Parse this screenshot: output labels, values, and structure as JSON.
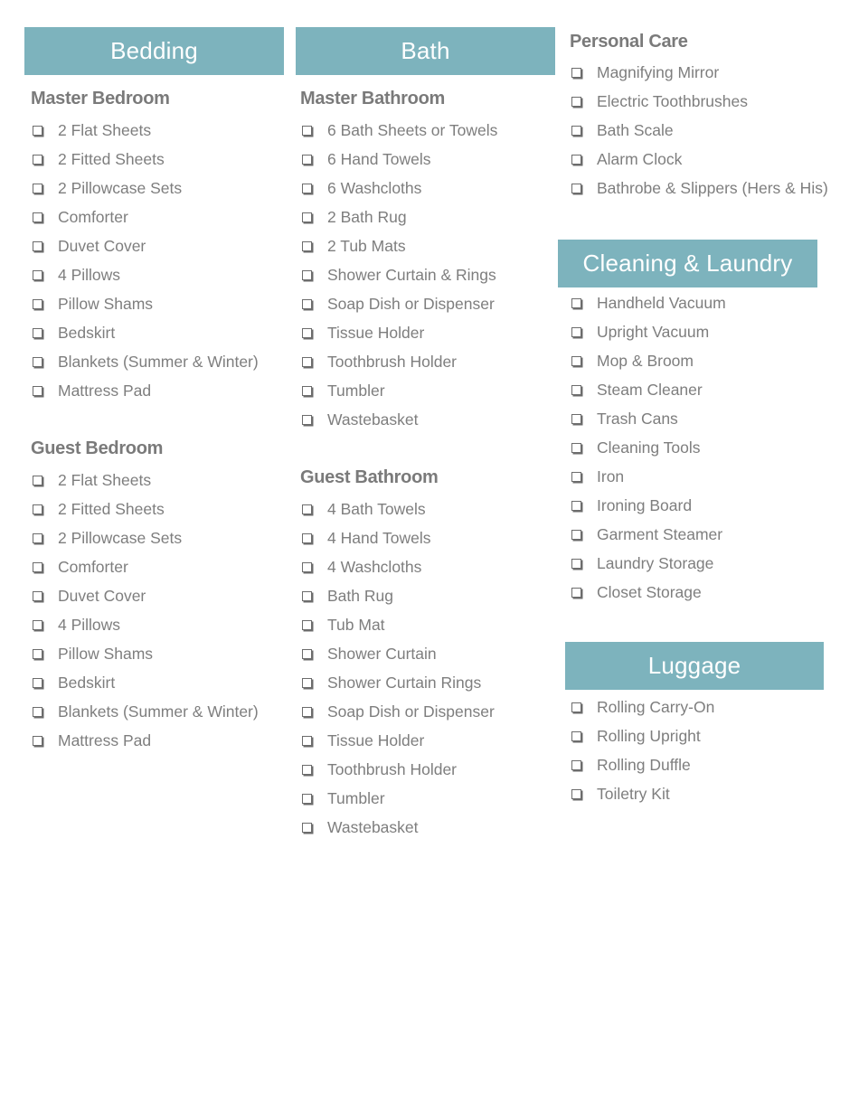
{
  "accent_color": "#7db3bd",
  "checkbox_icon": "checkbox-square-icon",
  "bedding": {
    "title": "Bedding",
    "master": {
      "title": "Master Bedroom",
      "items": [
        "2 Flat Sheets",
        "2 Fitted Sheets",
        "2 Pillowcase Sets",
        "Comforter",
        "Duvet Cover",
        "4 Pillows",
        "Pillow Shams",
        "Bedskirt",
        "Blankets (Summer & Winter)",
        "Mattress Pad"
      ]
    },
    "guest": {
      "title": "Guest Bedroom",
      "items": [
        "2 Flat Sheets",
        "2 Fitted Sheets",
        "2 Pillowcase Sets",
        "Comforter",
        "Duvet Cover",
        "4 Pillows",
        "Pillow Shams",
        "Bedskirt",
        "Blankets (Summer & Winter)",
        "Mattress Pad"
      ]
    }
  },
  "bath": {
    "title": "Bath",
    "master": {
      "title": "Master Bathroom",
      "items": [
        "6 Bath Sheets or Towels",
        "6 Hand Towels",
        "6 Washcloths",
        "2 Bath Rug",
        "2 Tub Mats",
        "Shower Curtain & Rings",
        "Soap Dish or Dispenser",
        "Tissue Holder",
        "Toothbrush Holder",
        "Tumbler",
        "Wastebasket"
      ]
    },
    "guest": {
      "title": "Guest Bathroom",
      "items": [
        "4 Bath Towels",
        "4 Hand Towels",
        "4 Washcloths",
        "Bath Rug",
        "Tub Mat",
        "Shower Curtain",
        "Shower Curtain Rings",
        "Soap Dish or Dispenser",
        "Tissue Holder",
        "Toothbrush Holder",
        "Tumbler",
        "Wastebasket"
      ]
    }
  },
  "personal_care": {
    "title": "Personal Care",
    "items": [
      "Magnifying Mirror",
      "Electric Toothbrushes",
      "Bath Scale",
      "Alarm Clock",
      "Bathrobe & Slippers (Hers & His)"
    ]
  },
  "cleaning": {
    "title": "Cleaning & Laundry",
    "items": [
      "Handheld Vacuum",
      "Upright Vacuum",
      "Mop & Broom",
      "Steam Cleaner",
      "Trash Cans",
      "Cleaning Tools",
      "Iron",
      "Ironing Board",
      "Garment Steamer",
      "Laundry Storage",
      "Closet Storage"
    ]
  },
  "luggage": {
    "title": "Luggage",
    "items": [
      "Rolling Carry-On",
      "Rolling Upright",
      "Rolling Duffle",
      "Toiletry Kit"
    ]
  }
}
